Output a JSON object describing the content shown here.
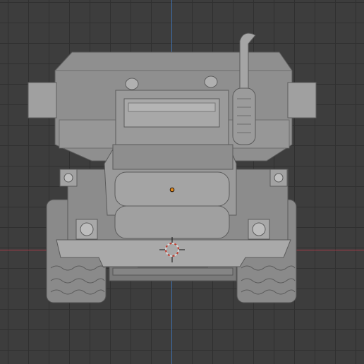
{
  "viewport": {
    "background": "#3d3d3d",
    "grid_color": "#303030",
    "x_axis_color": "#a63a48",
    "y_axis_color": "#3f6ea8"
  },
  "object": {
    "name_hidden": true,
    "shade_base": "#8e8e8e",
    "shade_light": "#a7a7a7",
    "shade_dark": "#6a6a6a",
    "origin_color": "#e08a1e"
  },
  "gizmos": {
    "origin_icon": "origin-dot-icon",
    "cursor_icon": "3d-cursor-icon"
  }
}
